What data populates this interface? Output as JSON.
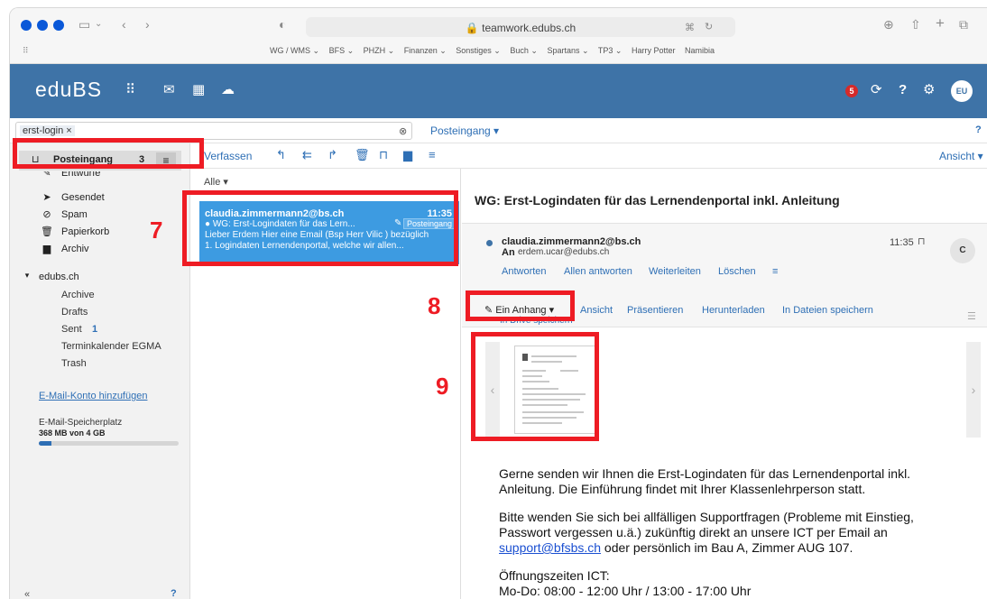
{
  "browser": {
    "url": "teamwork.edubs.ch",
    "bookmarks": [
      "WG / WMS ⌄",
      "BFS ⌄",
      "PHZH ⌄",
      "Finanzen ⌄",
      "Sonstiges ⌄",
      "Buch ⌄",
      "Spartans ⌄",
      "TP3 ⌄",
      "Harry Potter",
      "Namibia"
    ]
  },
  "app": {
    "logo": "eduBS",
    "notification_count": "5",
    "user_initials": "EU",
    "accent": "#3e73a7"
  },
  "search": {
    "token": "erst-login ×",
    "folder": "Posteingang ▾"
  },
  "sidebar": {
    "inbox": {
      "label": "Posteingang",
      "count": "3"
    },
    "drafts_label": "Entwürfe",
    "items": [
      {
        "label": "Gesendet",
        "icon": "send-icon"
      },
      {
        "label": "Spam",
        "icon": "spam-icon"
      },
      {
        "label": "Papierkorb",
        "icon": "trash-icon"
      },
      {
        "label": "Archiv",
        "icon": "archive-icon"
      }
    ],
    "account": "edubs.ch",
    "subfolders": [
      "Archive",
      "Drafts",
      "Sent",
      "Terminkalender EGMA",
      "Trash"
    ],
    "sent_count": "1",
    "add_account": "E-Mail-Konto hinzufügen",
    "storage_label": "E-Mail-Speicherplatz",
    "storage_value": "368 MB von 4 GB",
    "storage_fraction": 0.09
  },
  "toolbar": {
    "compose": "Verfassen",
    "view": "Ansicht ▾"
  },
  "list": {
    "filter": "Alle ▾",
    "selected": {
      "from": "claudia.zimmermann2@bs.ch",
      "time": "11:35",
      "subject": "● WG: Erst-Logindaten für das Lern...",
      "folder_tag": "Posteingang",
      "preview1": "Lieber Erdem Hier eine Email (Bsp Herr Vilic ) bezüglich",
      "preview2": "1. Logindaten Lernendenportal, welche wir allen..."
    }
  },
  "mail": {
    "subject": "WG: Erst-Logindaten für das Lernendenportal inkl. Anleitung",
    "from": "claudia.zimmermann2@bs.ch",
    "to_label": "An",
    "to": "erdem.ucar@edubs.ch",
    "time": "11:35",
    "avatar": "C",
    "actions": [
      "Antworten",
      "Allen antworten",
      "Weiterleiten",
      "Löschen"
    ],
    "attachment_button": "Ein Anhang",
    "attachment_actions": [
      "Ansicht",
      "Präsentieren",
      "Herunterladen",
      "In Dateien speichern"
    ],
    "drive_save": "In Drive speichern",
    "body": {
      "p1": "Gerne senden wir Ihnen die Erst-Logindaten für das Lernendenportal inkl. Anleitung. Die Einführung findet mit Ihrer Klassenlehrperson statt.",
      "p2_start": "Bitte wenden Sie sich bei allfälligen Supportfragen (Probleme mit Einstieg, Passwort vergessen u.ä.) zukünftig direkt an unsere ICT per Email an ",
      "p2_link": "support@bfsbs.ch",
      "p2_end": " oder persönlich im Bau A, Zimmer AUG 107.",
      "p3_title": "Öffnungszeiten ICT:",
      "p3_line": "Mo-Do: 08:00 - 12:00 Uhr / 13:00 - 17:00 Uhr"
    }
  },
  "annotations": {
    "n7": "7",
    "n8": "8",
    "n9": "9",
    "color": "#ee1c24"
  }
}
